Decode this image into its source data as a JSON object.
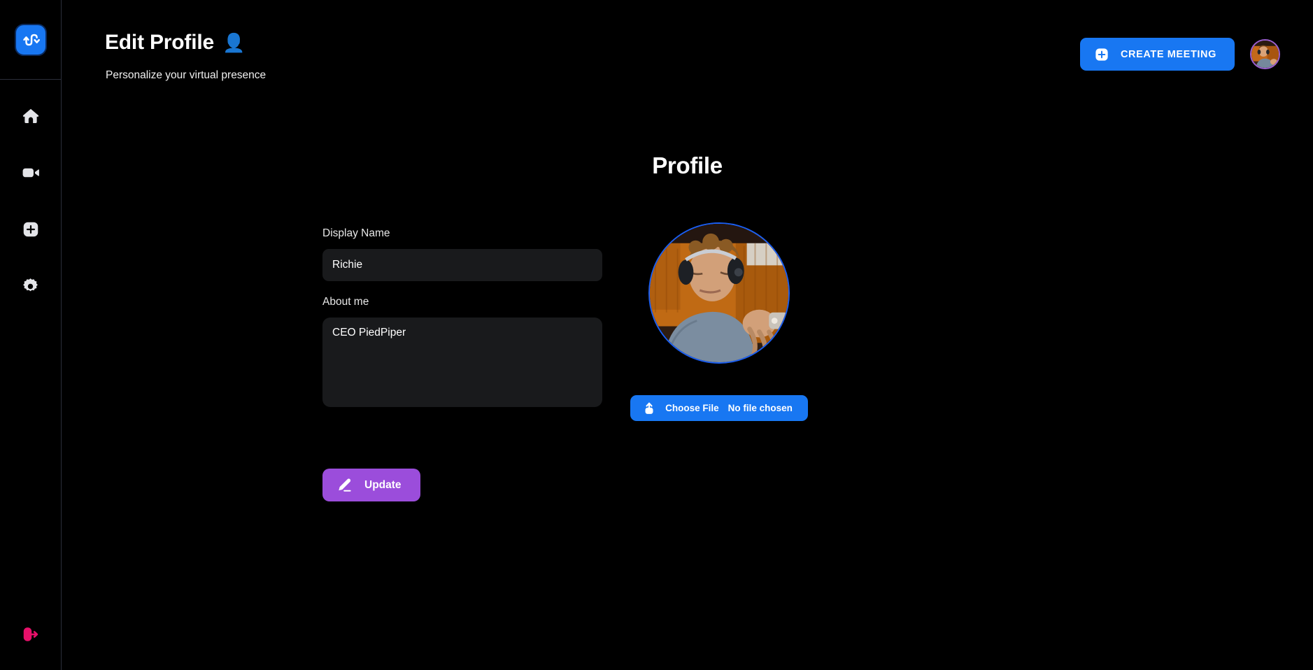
{
  "app": {
    "logo_icon": "swap-arrows-logo-icon",
    "background_color": "#000000",
    "accent_blue": "#1877f2",
    "accent_purple": "#9b4ddb",
    "accent_pink": "#e8106a"
  },
  "sidebar": {
    "items": [
      {
        "id": "home",
        "icon": "home-icon",
        "label": "Home"
      },
      {
        "id": "meetings",
        "icon": "video-camera-icon",
        "label": "Meetings"
      },
      {
        "id": "new",
        "icon": "plus-square-icon",
        "label": "New"
      },
      {
        "id": "settings",
        "icon": "gear-icon",
        "label": "Settings"
      }
    ],
    "logout": {
      "icon": "logout-icon",
      "label": "Logout",
      "color": "#e8106a"
    }
  },
  "header": {
    "title": "Edit Profile",
    "title_emoji": "👤",
    "subtitle": "Personalize your virtual presence",
    "create_meeting_label": "CREATE MEETING",
    "create_meeting_icon": "plus-square-icon",
    "avatar_icon": "user-avatar"
  },
  "profile": {
    "heading": "Profile",
    "display_name": {
      "label": "Display Name",
      "value": "Richie",
      "placeholder": "Display Name"
    },
    "about_me": {
      "label": "About me",
      "value": "CEO PiedPiper",
      "placeholder": "About me"
    },
    "update_button": {
      "label": "Update",
      "icon": "pencil-edit-icon"
    },
    "photo": {
      "ring_color": "#1a5ff5",
      "alt": "user-profile-photo"
    },
    "file_picker": {
      "button_label": "Choose File",
      "status_label": "No file chosen",
      "icon": "upload-icon"
    }
  }
}
